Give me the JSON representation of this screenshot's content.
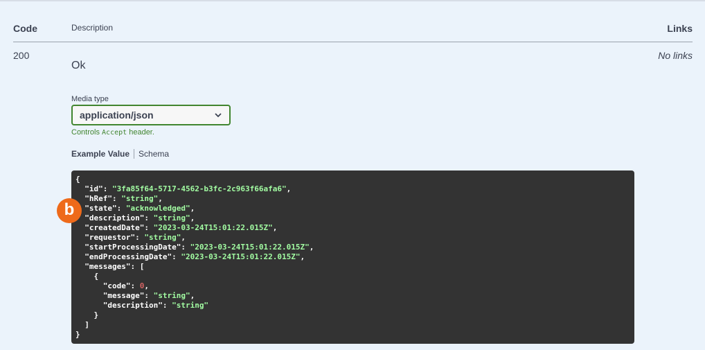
{
  "table": {
    "col_code": "Code",
    "col_description": "Description",
    "col_links": "Links"
  },
  "response": {
    "code": "200",
    "description": "Ok",
    "links": "No links",
    "media_label": "Media type",
    "media_value": "application/json",
    "controls_prefix": "Controls",
    "controls_code": "Accept",
    "controls_suffix": "header.",
    "tab_example": "Example Value",
    "tab_schema": "Schema"
  },
  "badge": {
    "letter": "b",
    "color": "#ee6a1a"
  },
  "colors": {
    "string": "#a2fca2",
    "number": "#d36363",
    "accent": "#41852f"
  },
  "example_json": [
    [
      {
        "t": "{",
        "c": "k"
      }
    ],
    [
      {
        "t": "  \"id\": ",
        "c": "k"
      },
      {
        "t": "\"3fa85f64-5717-4562-b3fc-2c963f66afa6\"",
        "c": "s"
      },
      {
        "t": ",",
        "c": "k"
      }
    ],
    [
      {
        "t": "  \"hRef\": ",
        "c": "k"
      },
      {
        "t": "\"string\"",
        "c": "s"
      },
      {
        "t": ",",
        "c": "k"
      }
    ],
    [
      {
        "t": "  \"state\": ",
        "c": "k"
      },
      {
        "t": "\"acknowledged\"",
        "c": "s"
      },
      {
        "t": ",",
        "c": "k"
      }
    ],
    [
      {
        "t": "  \"description\": ",
        "c": "k"
      },
      {
        "t": "\"string\"",
        "c": "s"
      },
      {
        "t": ",",
        "c": "k"
      }
    ],
    [
      {
        "t": "  \"createdDate\": ",
        "c": "k"
      },
      {
        "t": "\"2023-03-24T15:01:22.015Z\"",
        "c": "s"
      },
      {
        "t": ",",
        "c": "k"
      }
    ],
    [
      {
        "t": "  \"requestor\": ",
        "c": "k"
      },
      {
        "t": "\"string\"",
        "c": "s"
      },
      {
        "t": ",",
        "c": "k"
      }
    ],
    [
      {
        "t": "  \"startProcessingDate\": ",
        "c": "k"
      },
      {
        "t": "\"2023-03-24T15:01:22.015Z\"",
        "c": "s"
      },
      {
        "t": ",",
        "c": "k"
      }
    ],
    [
      {
        "t": "  \"endProcessingDate\": ",
        "c": "k"
      },
      {
        "t": "\"2023-03-24T15:01:22.015Z\"",
        "c": "s"
      },
      {
        "t": ",",
        "c": "k"
      }
    ],
    [
      {
        "t": "  \"messages\": [",
        "c": "k"
      }
    ],
    [
      {
        "t": "    {",
        "c": "k"
      }
    ],
    [
      {
        "t": "      \"code\": ",
        "c": "k"
      },
      {
        "t": "0",
        "c": "n"
      },
      {
        "t": ",",
        "c": "k"
      }
    ],
    [
      {
        "t": "      \"message\": ",
        "c": "k"
      },
      {
        "t": "\"string\"",
        "c": "s"
      },
      {
        "t": ",",
        "c": "k"
      }
    ],
    [
      {
        "t": "      \"description\": ",
        "c": "k"
      },
      {
        "t": "\"string\"",
        "c": "s"
      }
    ],
    [
      {
        "t": "    }",
        "c": "k"
      }
    ],
    [
      {
        "t": "  ]",
        "c": "k"
      }
    ],
    [
      {
        "t": "}",
        "c": "k"
      }
    ]
  ]
}
